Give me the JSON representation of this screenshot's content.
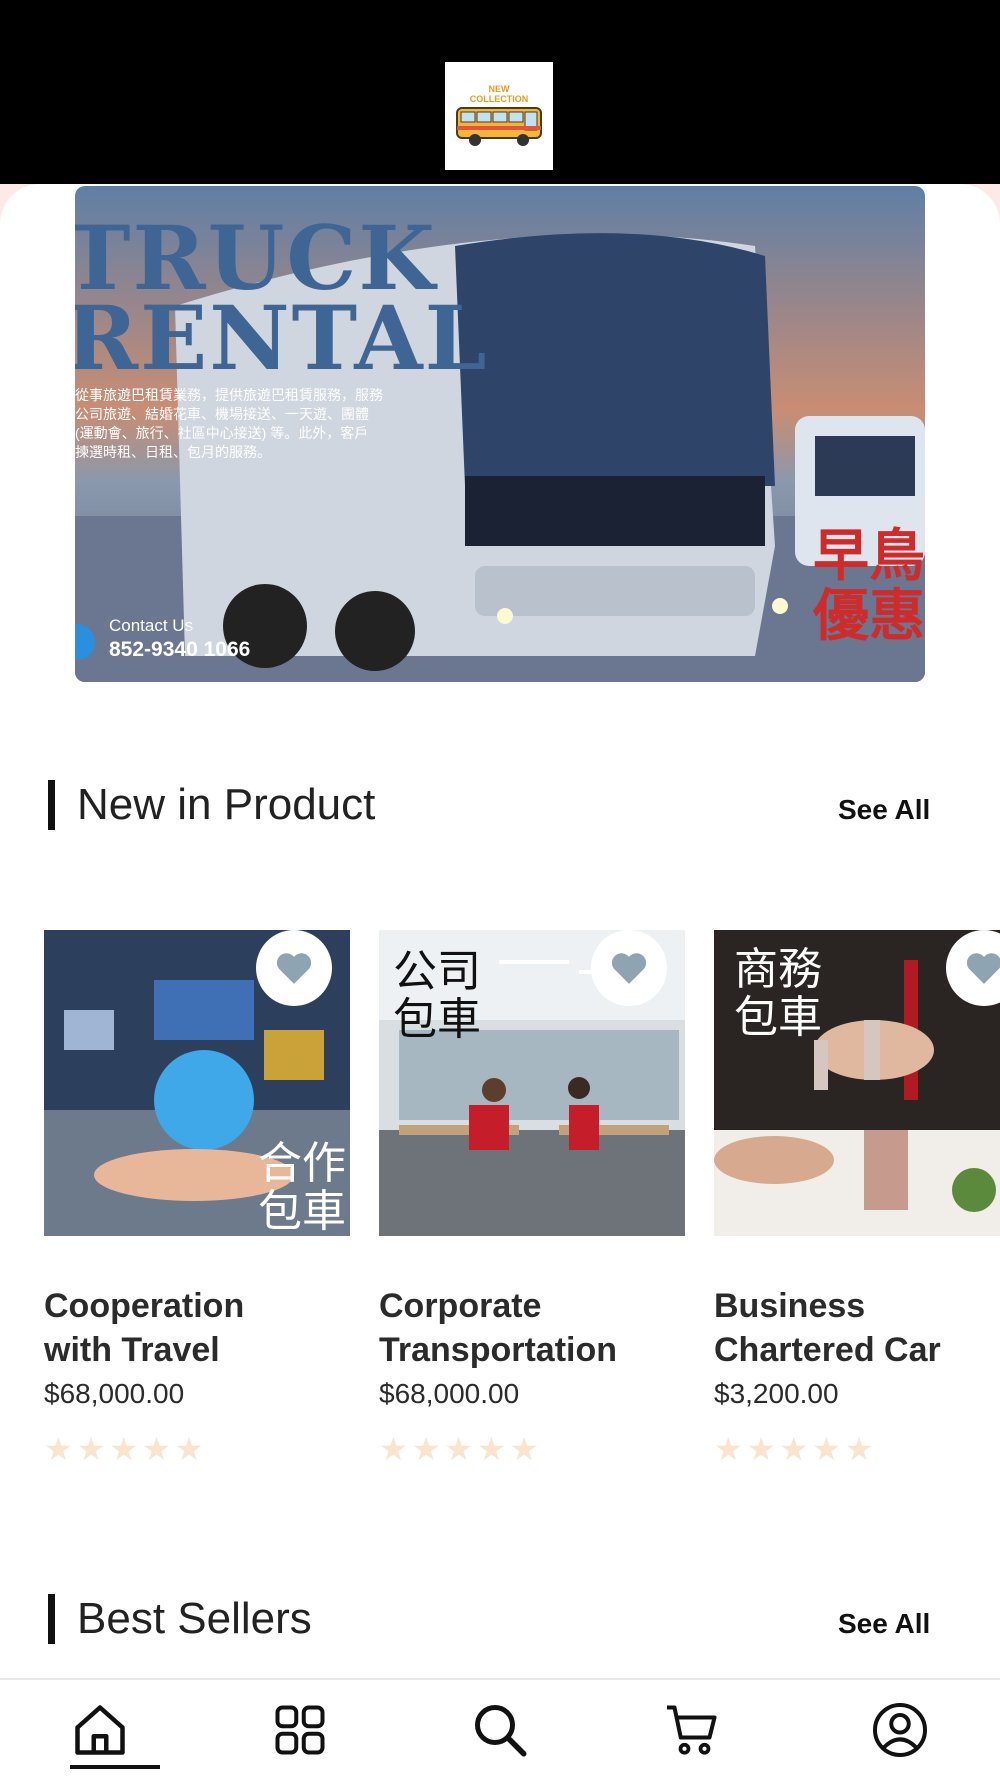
{
  "header": {
    "logo_text_line1": "NEW",
    "logo_text_line2": "COLLECTION"
  },
  "banner": {
    "title_line1": "TRUCK",
    "title_line2": "RENTAL",
    "description_lines": [
      "從事旅遊巴租賃業務，提供旅遊巴租賃服務，服務",
      "公司旅遊、結婚花車、機場接送、一天遊、團體",
      "(運動會、旅行、社區中心接送) 等。此外，客戶",
      "揀選時租、日租、包月的服務。"
    ],
    "contact_label": "Contact Us",
    "contact_phone": "852-9340 1066",
    "promo_line1": "早鳥",
    "promo_line2": "優惠"
  },
  "new_in_product": {
    "title": "New in Product",
    "see_all": "See All",
    "items": [
      {
        "name_line1": "Cooperation",
        "name_line2": "with Travel",
        "price": "$68,000.00",
        "overlay_line1": "合作",
        "overlay_line2": "包車",
        "rating": 5
      },
      {
        "name_line1": "Corporate",
        "name_line2": "Transportation",
        "price": "$68,000.00",
        "overlay_line1": "公司",
        "overlay_line2": "包車",
        "rating": 5
      },
      {
        "name_line1": "Business",
        "name_line2": "Chartered Car",
        "price": "$3,200.00",
        "overlay_line1": "商務",
        "overlay_line2": "包車",
        "rating": 5
      }
    ]
  },
  "best_sellers": {
    "title": "Best Sellers",
    "see_all": "See All"
  },
  "stars": "★★★★★",
  "colors": {
    "star": "#fbe3cc",
    "heart": "#8fa4b3",
    "promo_red": "#cf2b2b",
    "banner_text": "#3e6594"
  },
  "nav": {
    "items": [
      "home-icon",
      "grid-icon",
      "search-icon",
      "cart-icon",
      "user-icon"
    ]
  }
}
